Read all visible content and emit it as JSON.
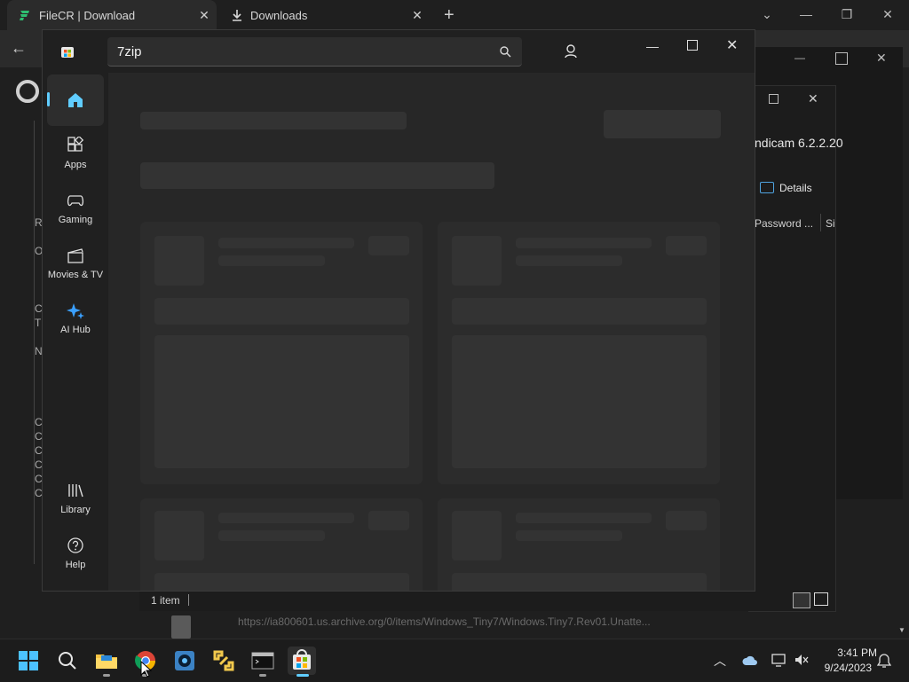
{
  "chrome": {
    "tabs": [
      {
        "title": "FileCR | Download"
      },
      {
        "title": "Downloads"
      }
    ],
    "new_tab_glyph": "+",
    "close_glyph": "✕"
  },
  "background": {
    "left_letters": [
      "R",
      "O",
      "C",
      "T",
      "N",
      "C",
      "C",
      "C",
      "C",
      "C",
      "C"
    ],
    "url_text": "https://ia800601.us.archive.org/0/items/Windows_Tiny7/Windows.Tiny7.Rev01.Unatte..."
  },
  "explorer": {
    "title_fragment": "ndicam 6.2.2.20",
    "details_label": "Details",
    "col_password": "Password ...",
    "col_size": "Si",
    "status_items": "1 item"
  },
  "store": {
    "search_query": "7zip",
    "nav": [
      {
        "label": "",
        "icon": "home-icon",
        "active": true
      },
      {
        "label": "Apps",
        "icon": "apps-icon"
      },
      {
        "label": "Gaming",
        "icon": "gamepad-icon"
      },
      {
        "label": "Movies & TV",
        "icon": "clapperboard-icon"
      },
      {
        "label": "AI Hub",
        "icon": "sparkle-icon"
      },
      {
        "label": "Library",
        "icon": "library-icon"
      },
      {
        "label": "Help",
        "icon": "help-icon"
      }
    ]
  },
  "taskbar": {
    "time": "3:41 PM",
    "date": "9/24/2023"
  },
  "colors": {
    "accent": "#60cdff",
    "store_bg": "#272727",
    "skeleton": "#333333"
  }
}
